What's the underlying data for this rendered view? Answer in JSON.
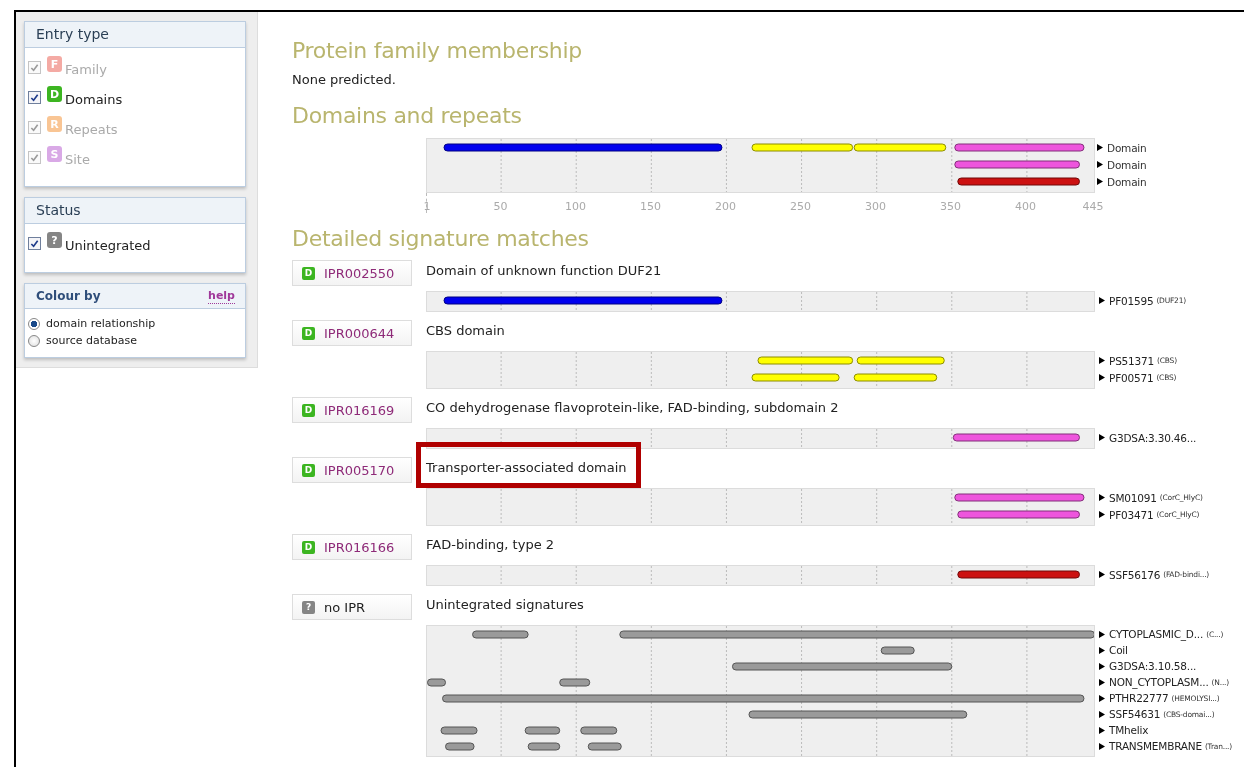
{
  "sidebar": {
    "entry_type": {
      "title": "Entry type",
      "items": [
        {
          "letter": "F",
          "label": "Family",
          "checked": true,
          "disabled": true,
          "color": "#f4aaa4"
        },
        {
          "letter": "D",
          "label": "Domains",
          "checked": true,
          "disabled": false,
          "color": "#3cb521"
        },
        {
          "letter": "R",
          "label": "Repeats",
          "checked": true,
          "disabled": true,
          "color": "#f9c594"
        },
        {
          "letter": "S",
          "label": "Site",
          "checked": true,
          "disabled": true,
          "color": "#d9a9e6"
        }
      ]
    },
    "status": {
      "title": "Status",
      "items": [
        {
          "letter": "?",
          "label": "Unintegrated",
          "checked": true,
          "disabled": false,
          "color": "#858585"
        }
      ]
    },
    "colour_by": {
      "title": "Colour by",
      "help": "help",
      "options": [
        {
          "label": "domain relationship",
          "selected": true
        },
        {
          "label": "source database",
          "selected": false
        }
      ]
    }
  },
  "family": {
    "heading": "Protein family membership",
    "text": "None predicted."
  },
  "domains": {
    "heading": "Domains and repeats",
    "rows": [
      {
        "label": "Domain"
      },
      {
        "label": "Domain"
      },
      {
        "label": "Domain"
      }
    ],
    "axis_labels": [
      "1",
      "50",
      "100",
      "150",
      "200",
      "250",
      "300",
      "350",
      "400",
      "445"
    ]
  },
  "signatures": {
    "heading": "Detailed signature matches",
    "entries": [
      {
        "badge": "D",
        "color": "#3cb521",
        "id": "IPR002550",
        "title": "Domain of unknown function DUF21",
        "highlighted": false,
        "rows": [
          {
            "label": "PF01595",
            "note": "(DUF21)"
          }
        ]
      },
      {
        "badge": "D",
        "color": "#3cb521",
        "id": "IPR000644",
        "title": "CBS domain",
        "highlighted": false,
        "rows": [
          {
            "label": "PS51371",
            "note": "(CBS)"
          },
          {
            "label": "PF00571",
            "note": "(CBS)"
          }
        ]
      },
      {
        "badge": "D",
        "color": "#3cb521",
        "id": "IPR016169",
        "title": "CO dehydrogenase flavoprotein-like, FAD-binding, subdomain 2",
        "highlighted": false,
        "rows": [
          {
            "label": "G3DSA:3.30.46..."
          }
        ]
      },
      {
        "badge": "D",
        "color": "#3cb521",
        "id": "IPR005170",
        "title": "Transporter-associated domain",
        "highlighted": true,
        "rows": [
          {
            "label": "SM01091",
            "note": "(CorC_HlyC)"
          },
          {
            "label": "PF03471",
            "note": "(CorC_HlyC)"
          }
        ]
      },
      {
        "badge": "D",
        "color": "#3cb521",
        "id": "IPR016166",
        "title": "FAD-binding, type 2",
        "highlighted": false,
        "rows": [
          {
            "label": "SSF56176",
            "note": "(FAD-bindi...)"
          }
        ]
      },
      {
        "badge": "?",
        "color": "#858585",
        "id": "no IPR",
        "title": "Unintegrated signatures",
        "highlighted": false,
        "rows": [
          {
            "label": "CYTOPLASMIC_D...",
            "note": "(C...)"
          },
          {
            "label": "Coil"
          },
          {
            "label": "G3DSA:3.10.58..."
          },
          {
            "label": "NON_CYTOPLASM...",
            "note": "(N...)"
          },
          {
            "label": "PTHR22777",
            "note": "(HEMOLYSI...)"
          },
          {
            "label": "SSF54631",
            "note": "(CBS-domai...)"
          },
          {
            "label": "TMhelix"
          },
          {
            "label": "TRANSMEMBRANE",
            "note": "(Tran...)"
          }
        ]
      }
    ]
  }
}
